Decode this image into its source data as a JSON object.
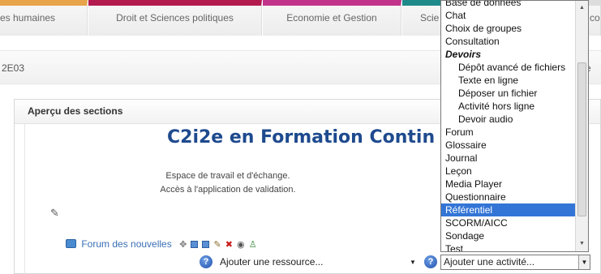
{
  "tabs": [
    {
      "label": "es humaines"
    },
    {
      "label": "Droit et Sciences politiques"
    },
    {
      "label": "Economie et Gestion"
    },
    {
      "label": "Scie"
    },
    {
      "label": "co"
    }
  ],
  "codebar": {
    "code": "2E03",
    "right_fragment": "e"
  },
  "section": {
    "header": "Aperçu des sections",
    "course_title": "C2i2e en Formation Contin",
    "desc_line1": "Espace de travail et d'échange.",
    "desc_line2": "Accès à l'application de validation."
  },
  "forum": {
    "link": "Forum des nouvelles"
  },
  "add_resource": {
    "value": "Ajouter une ressource..."
  },
  "add_activity": {
    "value": "Ajouter une activité..."
  },
  "dropdown": {
    "items": [
      {
        "label": "Base de données",
        "kind": "item"
      },
      {
        "label": "Chat",
        "kind": "item"
      },
      {
        "label": "Choix de groupes",
        "kind": "item"
      },
      {
        "label": "Consultation",
        "kind": "item"
      },
      {
        "label": "Devoirs",
        "kind": "group"
      },
      {
        "label": "Dépôt avancé de fichiers",
        "kind": "sub"
      },
      {
        "label": "Texte en ligne",
        "kind": "sub"
      },
      {
        "label": "Déposer un fichier",
        "kind": "sub"
      },
      {
        "label": "Activité hors ligne",
        "kind": "sub"
      },
      {
        "label": "Devoir audio",
        "kind": "sub"
      },
      {
        "label": "Forum",
        "kind": "item"
      },
      {
        "label": "Glossaire",
        "kind": "item"
      },
      {
        "label": "Journal",
        "kind": "item"
      },
      {
        "label": "Leçon",
        "kind": "item"
      },
      {
        "label": "Media Player",
        "kind": "item"
      },
      {
        "label": "Questionnaire",
        "kind": "item"
      },
      {
        "label": "Référentiel",
        "kind": "item",
        "selected": true
      },
      {
        "label": "SCORM/AICC",
        "kind": "item"
      },
      {
        "label": "Sondage",
        "kind": "item"
      },
      {
        "label": "Test",
        "kind": "item"
      }
    ]
  },
  "colors": {
    "title_blue": "#1e4a8e",
    "link_blue": "#3a6fb6",
    "selection_blue": "#3375d6",
    "tab_orange": "#e8a44a",
    "tab_crimson": "#b31b4f",
    "tab_magenta": "#c2338a",
    "tab_teal": "#1f8a8a"
  }
}
